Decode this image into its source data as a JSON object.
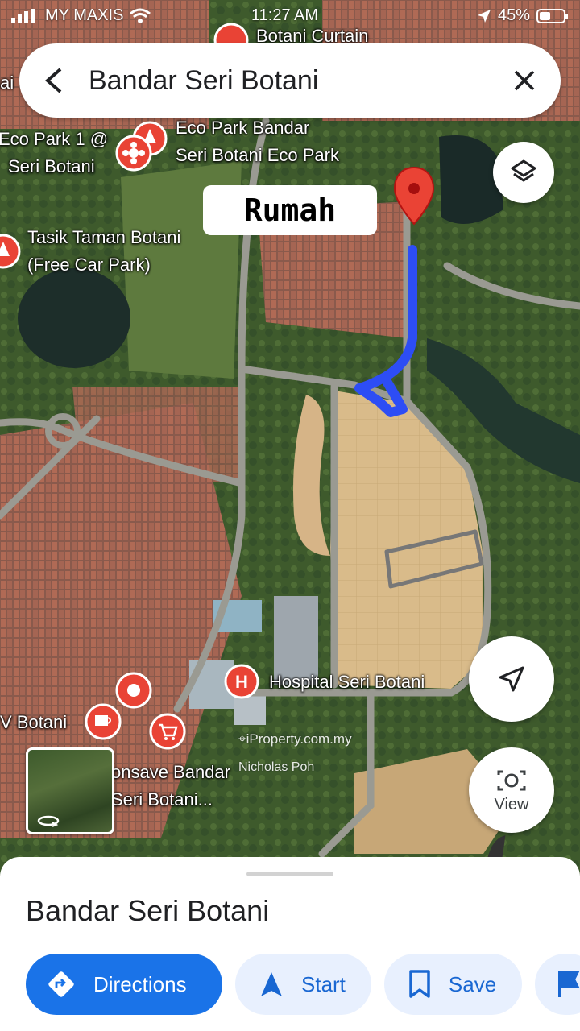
{
  "status_bar": {
    "carrier": "MY MAXIS",
    "time": "11:27 AM",
    "battery": "45%",
    "battery_level": 0.45
  },
  "search": {
    "query": "Bandar Seri Botani"
  },
  "map": {
    "labels": {
      "curtain": "Botani Curtain",
      "eco_park_left": [
        "Eco Park 1 @",
        "Seri Botani"
      ],
      "eco_park": [
        "Eco Park Bandar",
        "Seri Botani Eco Park"
      ],
      "tasik": [
        "Tasik Taman Botani",
        "(Free Car Park)"
      ],
      "hospital": "Hospital Seri Botani",
      "v_botani": "V Botani",
      "econsave": [
        "onsave Bandar",
        "Seri Botani..."
      ],
      "left_edge": "ai"
    },
    "annotation": "Rumah",
    "watermark": "iProperty.com.my",
    "watermark_author": "Nicholas Poh"
  },
  "buttons": {
    "view": "View"
  },
  "sheet": {
    "title": "Bandar Seri Botani",
    "directions": "Directions",
    "start": "Start",
    "save": "Save"
  },
  "colors": {
    "accent": "#1a73e8",
    "accent_light": "#e8f0fe",
    "pin": "#ea4335",
    "drawing": "#2d4df5"
  }
}
